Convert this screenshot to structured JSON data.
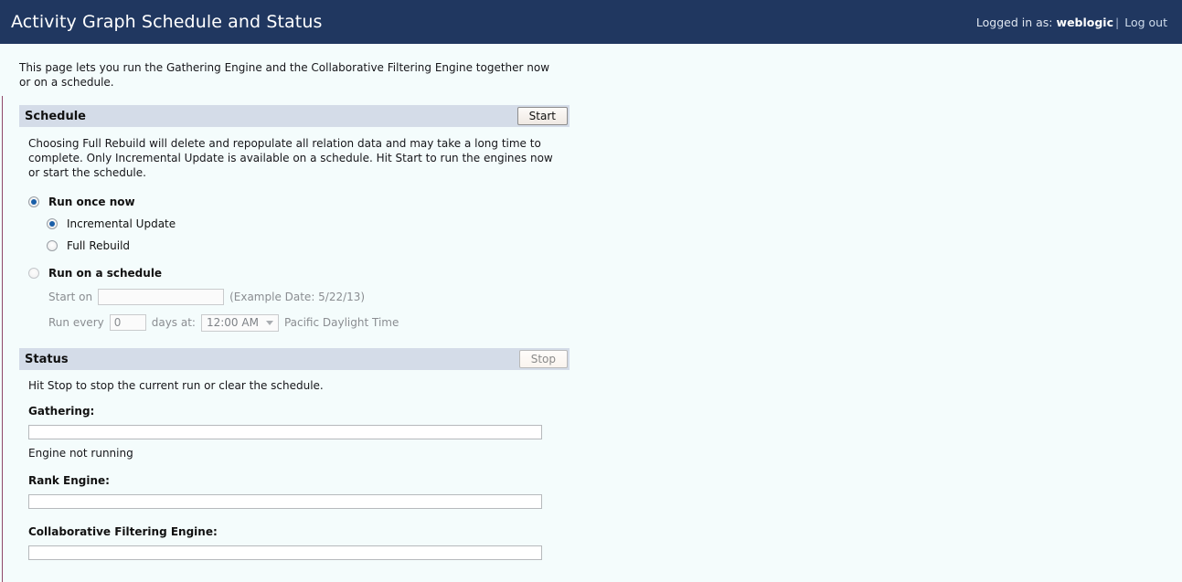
{
  "banner": {
    "title": "Activity Graph Schedule and Status",
    "logged_in_prefix": "Logged in as:",
    "username": "weblogic",
    "separator": "|",
    "logout_label": "Log out",
    "background_color": "#203760"
  },
  "page": {
    "intro": "This page lets you run the Gathering Engine and the Collaborative Filtering Engine together now or on a schedule.",
    "background_color": "#f4fcfc",
    "section_bar_color": "#d4dce8"
  },
  "schedule": {
    "title": "Schedule",
    "start_button": "Start",
    "help": "Choosing Full Rebuild will delete and repopulate all relation data and may take a long time to complete. Only Incremental Update is available on a schedule. Hit Start to run the engines now or start the schedule.",
    "run_mode": {
      "run_once_label": "Run once now",
      "run_once_selected": true,
      "run_schedule_label": "Run on a schedule",
      "run_schedule_selected": false
    },
    "run_once_options": [
      {
        "label": "Incremental Update",
        "selected": true
      },
      {
        "label": "Full Rebuild",
        "selected": false
      }
    ],
    "schedule_fields": {
      "start_on_label": "Start on",
      "start_on_value": "",
      "start_on_hint": "(Example Date: 5/22/13)",
      "run_every_label": "Run every",
      "run_every_value": "0",
      "days_at_label": "days at:",
      "time_value": "12:00 AM",
      "timezone": "Pacific Daylight Time",
      "disabled": true
    }
  },
  "status": {
    "title": "Status",
    "stop_button": "Stop",
    "stop_disabled": true,
    "note": "Hit Stop to stop the current run or clear the schedule.",
    "engines": [
      {
        "label": "Gathering:",
        "progress": 0,
        "state": "Engine not running"
      },
      {
        "label": "Rank Engine:",
        "progress": 0,
        "state": ""
      },
      {
        "label": "Collaborative Filtering Engine:",
        "progress": 0,
        "state": ""
      }
    ]
  }
}
